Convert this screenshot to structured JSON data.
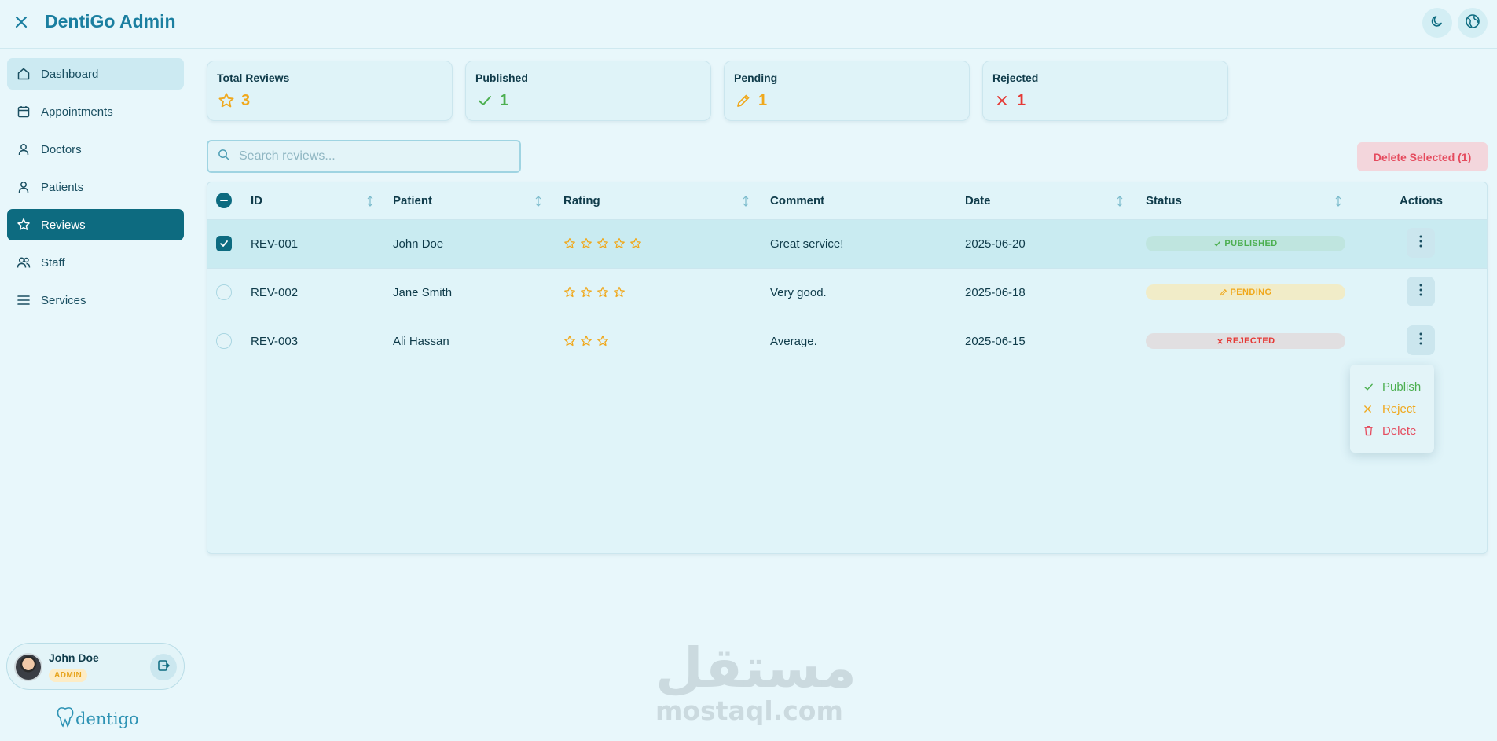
{
  "app": {
    "title": "DentiGo Admin"
  },
  "sidebar": {
    "items": [
      {
        "label": "Dashboard",
        "icon": "home-icon"
      },
      {
        "label": "Appointments",
        "icon": "calendar-icon"
      },
      {
        "label": "Doctors",
        "icon": "user-icon"
      },
      {
        "label": "Patients",
        "icon": "user-icon"
      },
      {
        "label": "Reviews",
        "icon": "star-icon",
        "active": true
      },
      {
        "label": "Staff",
        "icon": "users-icon"
      },
      {
        "label": "Services",
        "icon": "list-icon"
      }
    ],
    "user": {
      "name": "John Doe",
      "role": "ADMIN"
    },
    "brand": "dentigo"
  },
  "stats": [
    {
      "label": "Total Reviews",
      "value": "3",
      "icon": "star-icon",
      "color": "#f0a81c"
    },
    {
      "label": "Published",
      "value": "1",
      "icon": "check-icon",
      "color": "#4caf50"
    },
    {
      "label": "Pending",
      "value": "1",
      "icon": "pencil-icon",
      "color": "#f0a81c"
    },
    {
      "label": "Rejected",
      "value": "1",
      "icon": "x-icon",
      "color": "#e53935"
    }
  ],
  "search": {
    "placeholder": "Search reviews..."
  },
  "actions": {
    "delete_selected": "Delete Selected (1)"
  },
  "table": {
    "headers": {
      "id": "ID",
      "patient": "Patient",
      "rating": "Rating",
      "comment": "Comment",
      "date": "Date",
      "status": "Status",
      "actions": "Actions"
    },
    "rows": [
      {
        "id": "REV-001",
        "patient": "John Doe",
        "rating": 5,
        "comment": "Great service!",
        "date": "2025-06-20",
        "status": "PUBLISHED",
        "selected": true
      },
      {
        "id": "REV-002",
        "patient": "Jane Smith",
        "rating": 4,
        "comment": "Very good.",
        "date": "2025-06-18",
        "status": "PENDING",
        "selected": false
      },
      {
        "id": "REV-003",
        "patient": "Ali Hassan",
        "rating": 3,
        "comment": "Average.",
        "date": "2025-06-15",
        "status": "REJECTED",
        "selected": false
      }
    ]
  },
  "menu": {
    "publish": "Publish",
    "reject": "Reject",
    "delete": "Delete"
  },
  "colors": {
    "accent": "#0d6b80",
    "published": "#4caf50",
    "pending": "#f0a81c",
    "rejected": "#e53935"
  },
  "watermark": {
    "arabic": "مستقل",
    "latin": "mostaql.com"
  }
}
